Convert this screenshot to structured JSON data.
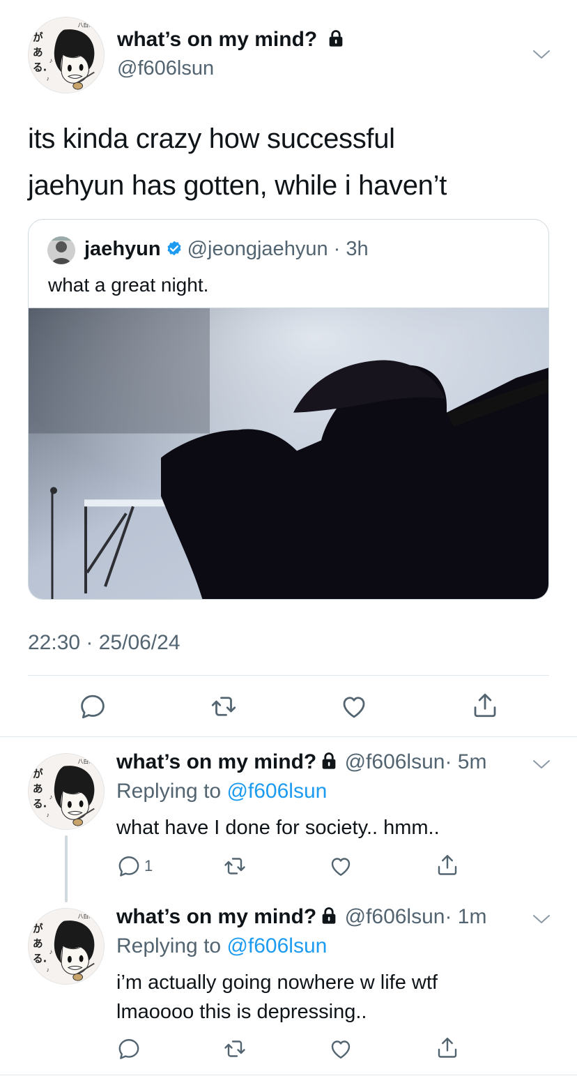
{
  "main_tweet": {
    "display_name": "what’s on my mind?",
    "handle": "@f606lsun",
    "text_line1": "its kinda crazy how successful",
    "text_line2": "jaehyun has gotten, while i haven’t",
    "timestamp": "22:30 · 25/06/24",
    "quote": {
      "display_name": "jaehyun",
      "handle": "@jeongjaehyun",
      "time": "· 3h",
      "text": "what a great night."
    }
  },
  "avatar_text": {
    "top_label": "八白.",
    "side_label": "がある."
  },
  "replies": [
    {
      "display_name": "what’s on my mind?",
      "handle": "@f606lsun",
      "time": "· 5m",
      "replying_prefix": "Replying to",
      "replying_to": "@f606lsun",
      "text_line1": "what have I done for society.. hmm..",
      "text_line2": "",
      "reply_count": "1"
    },
    {
      "display_name": "what’s on my mind?",
      "handle": "@f606lsun",
      "time": "· 1m",
      "replying_prefix": "Replying to",
      "replying_to": "@f606lsun",
      "text_line1": "i’m actually going nowhere w life wtf",
      "text_line2": "lmaoooo this is depressing..",
      "reply_count": ""
    }
  ],
  "icons": {
    "reply": "reply-icon",
    "retweet": "retweet-icon",
    "like": "like-icon",
    "share": "share-icon",
    "lock": "lock-icon",
    "verified": "verified-badge-icon",
    "chevron": "chevron-down-icon"
  },
  "colors": {
    "link": "#1d9bf0",
    "muted": "#536471",
    "verified": "#1d9bf0",
    "divider": "#e1e8ed"
  }
}
